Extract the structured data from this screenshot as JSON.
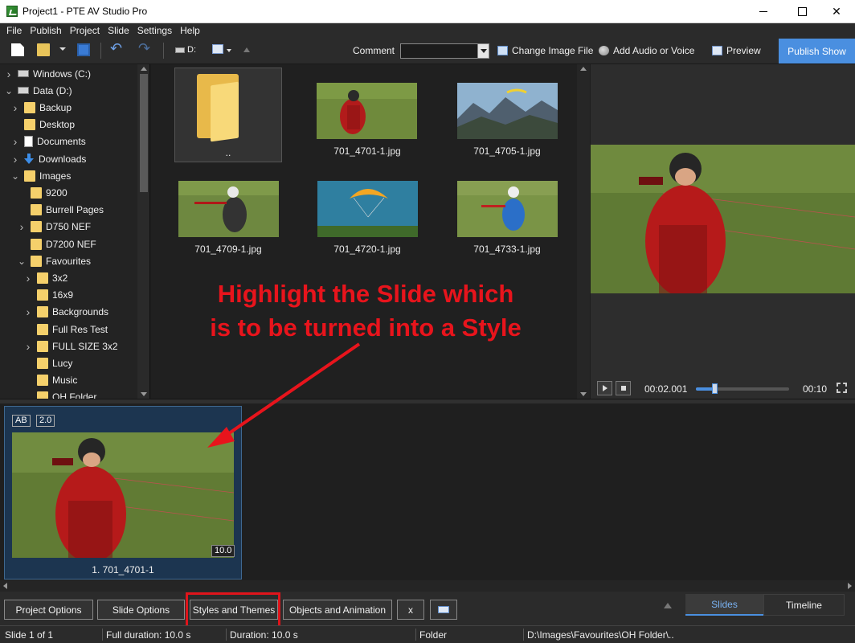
{
  "window": {
    "title": "Project1 - PTE AV Studio Pro"
  },
  "menu": [
    "File",
    "Publish",
    "Project",
    "Slide",
    "Settings",
    "Help"
  ],
  "toolbar": {
    "drive_label": "D:",
    "comment_label": "Comment",
    "comment_value": "",
    "change_image": "Change Image File",
    "add_audio": "Add Audio or Voice",
    "preview": "Preview",
    "publish": "Publish Show"
  },
  "tree": {
    "items": [
      {
        "label": "Windows (C:)",
        "icon": "drive-icon",
        "expand": "collapsed"
      },
      {
        "label": "Data (D:)",
        "icon": "drive-icon",
        "expand": "expanded"
      },
      {
        "label": "Backup",
        "icon": "folder-icon",
        "expand": "collapsed"
      },
      {
        "label": "Desktop",
        "icon": "folder-icon",
        "expand": "none"
      },
      {
        "label": "Documents",
        "icon": "documents-icon",
        "expand": "collapsed"
      },
      {
        "label": "Downloads",
        "icon": "download-icon",
        "expand": "collapsed"
      },
      {
        "label": "Images",
        "icon": "folder-icon",
        "expand": "expanded"
      },
      {
        "label": "9200",
        "icon": "folder-icon",
        "expand": "none"
      },
      {
        "label": "Burrell Pages",
        "icon": "folder-icon",
        "expand": "none"
      },
      {
        "label": "D750 NEF",
        "icon": "folder-icon",
        "expand": "collapsed"
      },
      {
        "label": "D7200 NEF",
        "icon": "folder-icon",
        "expand": "none"
      },
      {
        "label": "Favourites",
        "icon": "folder-icon",
        "expand": "expanded"
      },
      {
        "label": "3x2",
        "icon": "folder-icon",
        "expand": "collapsed"
      },
      {
        "label": "16x9",
        "icon": "folder-icon",
        "expand": "none"
      },
      {
        "label": "Backgrounds",
        "icon": "folder-icon",
        "expand": "collapsed"
      },
      {
        "label": "Full Res Test",
        "icon": "folder-icon",
        "expand": "none"
      },
      {
        "label": "FULL SIZE 3x2",
        "icon": "folder-icon",
        "expand": "collapsed"
      },
      {
        "label": "Lucy",
        "icon": "folder-icon",
        "expand": "none"
      },
      {
        "label": "Music",
        "icon": "folder-icon",
        "expand": "none"
      },
      {
        "label": "OH Folder",
        "icon": "folder-icon",
        "expand": "none"
      }
    ]
  },
  "files": {
    "items": [
      {
        "name": "..",
        "kind": "folder-up"
      },
      {
        "name": "701_4701-1.jpg",
        "kind": "photo-paraglider-red"
      },
      {
        "name": "701_4705-1.jpg",
        "kind": "photo-mountains"
      },
      {
        "name": "701_4709-1.jpg",
        "kind": "photo-paraglider-back"
      },
      {
        "name": "701_4720-1.jpg",
        "kind": "photo-canopy"
      },
      {
        "name": "701_4733-1.jpg",
        "kind": "photo-paraglider-blue"
      }
    ]
  },
  "player": {
    "current_time": "00:02.001",
    "end_time": "00:10",
    "progress": 0.2
  },
  "slides": [
    {
      "badge_ab": "AB",
      "badge_ver": "2.0",
      "duration": "10.0",
      "label": "1. 701_4701-1"
    }
  ],
  "annotation": {
    "line1": "Highlight the Slide which",
    "line2": "is to be turned into a Style"
  },
  "bottom_buttons": {
    "project_options": "Project Options",
    "slide_options": "Slide Options",
    "styles_themes": "Styles and Themes",
    "objects_animation": "Objects and Animation",
    "x": "x"
  },
  "tabs": {
    "slides": "Slides",
    "timeline": "Timeline"
  },
  "status": {
    "slide": "Slide 1 of 1",
    "full_duration": "Full duration: 10.0 s",
    "duration": "Duration: 10.0 s",
    "type": "Folder",
    "path": "D:\\Images\\Favourites\\OH Folder\\.."
  },
  "colors": {
    "accent": "#4a8fe0",
    "annotation": "#e8141c",
    "folder": "#f5d06b"
  }
}
